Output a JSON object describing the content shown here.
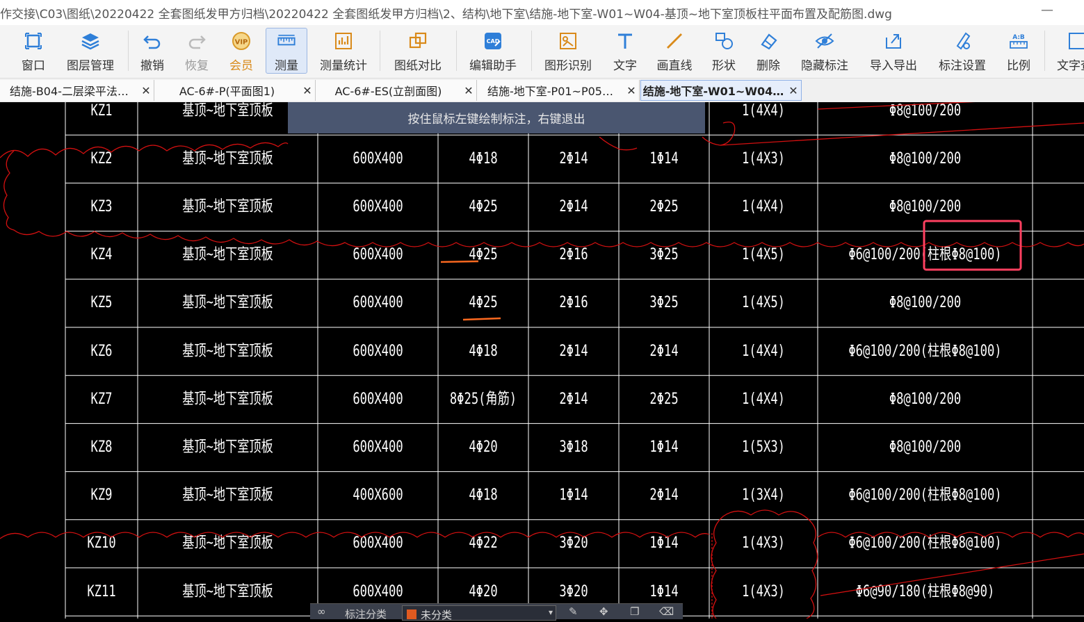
{
  "window": {
    "title": "作交接\\C03\\图纸\\20220422 全套图纸发甲方归档\\20220422 全套图纸发甲方归档\\2、结构\\地下室\\结施-地下室-W01~W04-基顶~地下室顶板柱平面布置及配筋图.dwg",
    "minimize": "—"
  },
  "toolbar": {
    "items": [
      {
        "label": "窗口",
        "icon": "window-icon"
      },
      {
        "label": "图层管理",
        "icon": "layers-icon"
      },
      {
        "label": "撤销",
        "icon": "undo-icon"
      },
      {
        "label": "恢复",
        "icon": "redo-icon"
      },
      {
        "label": "会员",
        "icon": "vip-icon"
      },
      {
        "label": "测量",
        "icon": "ruler-icon"
      },
      {
        "label": "测量统计",
        "icon": "stats-icon"
      },
      {
        "label": "图纸对比",
        "icon": "compare-icon"
      },
      {
        "label": "编辑助手",
        "icon": "cad-edit-icon"
      },
      {
        "label": "图形识别",
        "icon": "shape-recognize-icon"
      },
      {
        "label": "文字",
        "icon": "text-icon"
      },
      {
        "label": "画直线",
        "icon": "line-icon"
      },
      {
        "label": "形状",
        "icon": "shape-icon"
      },
      {
        "label": "删除",
        "icon": "eraser-icon"
      },
      {
        "label": "隐藏标注",
        "icon": "eye-off-icon"
      },
      {
        "label": "导入导出",
        "icon": "import-export-icon"
      },
      {
        "label": "标注设置",
        "icon": "annotation-settings-icon"
      },
      {
        "label": "比例",
        "icon": "scale-icon"
      },
      {
        "label": "文字查找",
        "icon": "text-search-icon"
      }
    ],
    "vip_badge": "VIP",
    "scale_badge": "A:B",
    "cad_badge": "CAD"
  },
  "tabs": [
    {
      "label": "结施-B04-二层梁平法…"
    },
    {
      "label": "AC-6#-P(平面图1)"
    },
    {
      "label": "AC-6#-ES(立剖面图)"
    },
    {
      "label": "结施-地下室-P01~P05…"
    },
    {
      "label": "结施-地下室-W01~W04…"
    }
  ],
  "tab_close": "✕",
  "hint": "按住鼠标左键绘制标注，右键退出",
  "table": {
    "partial_row": [
      "KZ1",
      "基顶~地下室顶板",
      "",
      "",
      "",
      "",
      "1(4X4)",
      "Φ8@100/200"
    ],
    "rows": [
      [
        "KZ2",
        "基顶~地下室顶板",
        "600X400",
        "4Φ18",
        "2Φ14",
        "1Φ14",
        "1(4X3)",
        "Φ8@100/200"
      ],
      [
        "KZ3",
        "基顶~地下室顶板",
        "600X400",
        "4Φ25",
        "2Φ14",
        "2Φ25",
        "1(4X4)",
        "Φ8@100/200"
      ],
      [
        "KZ4",
        "基顶~地下室顶板",
        "600X400",
        "4Φ25",
        "2Φ16",
        "3Φ25",
        "1(4X5)",
        "Φ6@100/200(柱根Φ8@100)"
      ],
      [
        "KZ5",
        "基顶~地下室顶板",
        "600X400",
        "4Φ25",
        "2Φ16",
        "3Φ25",
        "1(4X5)",
        "Φ8@100/200"
      ],
      [
        "KZ6",
        "基顶~地下室顶板",
        "600X400",
        "4Φ18",
        "2Φ14",
        "2Φ14",
        "1(4X4)",
        "Φ6@100/200(柱根Φ8@100)"
      ],
      [
        "KZ7",
        "基顶~地下室顶板",
        "600X400",
        "8Φ25(角筋)",
        "2Φ14",
        "2Φ25",
        "1(4X4)",
        "Φ8@100/200"
      ],
      [
        "KZ8",
        "基顶~地下室顶板",
        "600X400",
        "4Φ20",
        "3Φ18",
        "1Φ14",
        "1(5X3)",
        "Φ8@100/200"
      ],
      [
        "KZ9",
        "基顶~地下室顶板",
        "400X600",
        "4Φ18",
        "1Φ14",
        "2Φ14",
        "1(3X4)",
        "Φ6@100/200(柱根Φ8@100)"
      ],
      [
        "KZ10",
        "基顶~地下室顶板",
        "600X400",
        "4Φ22",
        "3Φ20",
        "1Φ14",
        "1(4X3)",
        "Φ6@100/200(柱根Φ8@100)"
      ],
      [
        "KZ11",
        "基顶~地下室顶板",
        "600X400",
        "4Φ20",
        "3Φ20",
        "1Φ14",
        "1(4X3)",
        "Φ6@90/180(柱根Φ8@90)"
      ]
    ]
  },
  "bottom_panel": {
    "label": "标注分类",
    "selected": "未分类"
  },
  "colors": {
    "cad_background": "#000000",
    "table_line": "#ffffff",
    "revision_cloud": "#e01010",
    "highlight_box": "#ff4060",
    "markup_underline": "#ff6a20",
    "hint_background": "#4a5670"
  }
}
